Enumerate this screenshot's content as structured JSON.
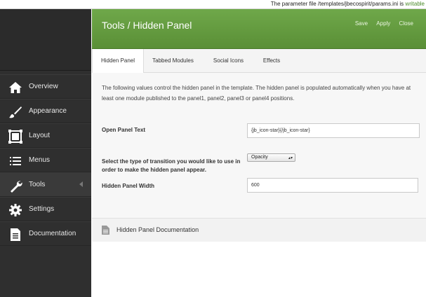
{
  "notice": {
    "prefix": "The parameter file /templates/jbecospirit/params.ini is",
    "status": "writable"
  },
  "sidebar": {
    "items": [
      {
        "label": "Overview",
        "icon": "home-icon"
      },
      {
        "label": "Appearance",
        "icon": "brush-icon"
      },
      {
        "label": "Layout",
        "icon": "layout-icon"
      },
      {
        "label": "Menus",
        "icon": "menu-list-icon"
      },
      {
        "label": "Tools",
        "icon": "wrench-icon"
      },
      {
        "label": "Settings",
        "icon": "gear-icon"
      },
      {
        "label": "Documentation",
        "icon": "document-icon"
      }
    ]
  },
  "header": {
    "title": "Tools / Hidden Panel",
    "save": "Save",
    "apply": "Apply",
    "close": "Close"
  },
  "tabs": [
    {
      "label": "Hidden Panel"
    },
    {
      "label": "Tabbed Modules"
    },
    {
      "label": "Social Icons"
    },
    {
      "label": "Effects"
    }
  ],
  "content": {
    "intro": "The following values control the hidden panel in the template. The hidden panel is populated automatically when you have at least one module published to the panel1, panel2, panel3 or panel4 positions.",
    "open_panel_text": {
      "label": "Open Panel Text",
      "value": "{jb_icon-star}{/jb_icon-star}"
    },
    "transition": {
      "label": "Select the type of transition you would like to use in order to make the hidden panel appear.",
      "value": "Opacity"
    },
    "panel_width": {
      "label": "Hidden Panel Width",
      "value": "600"
    }
  },
  "documentation": {
    "title": "Hidden Panel Documentation"
  },
  "colors": {
    "header_green": "#5f9a3b",
    "sidebar": "#2f2f2f"
  }
}
